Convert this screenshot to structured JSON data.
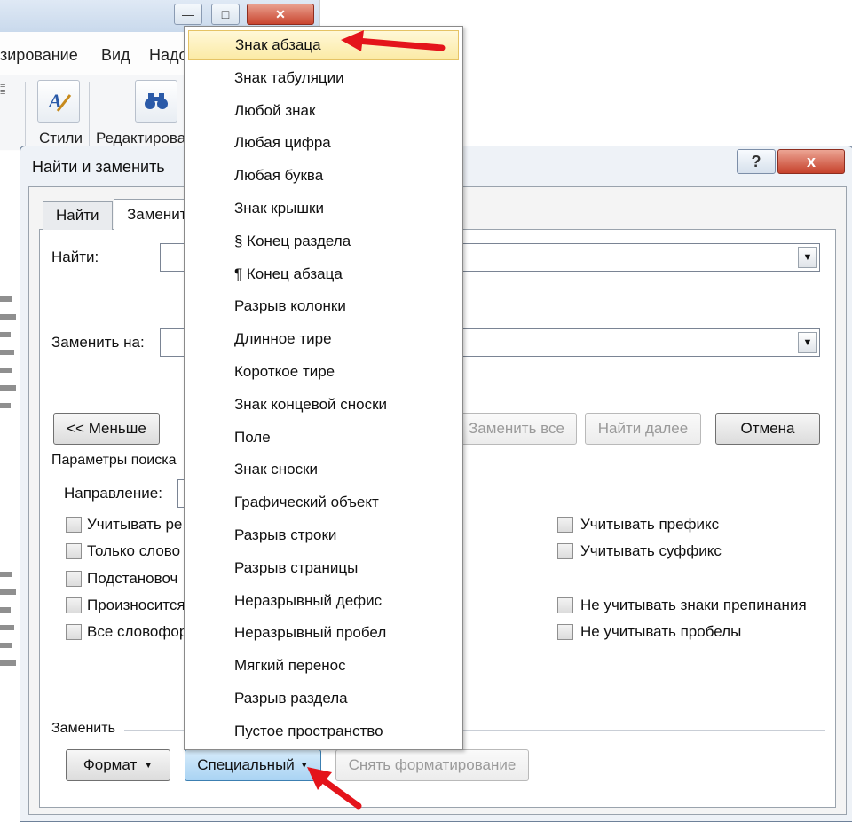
{
  "word": {
    "ribbon_tabs": [
      "зирование",
      "Вид",
      "Надо"
    ],
    "groups": [
      {
        "label": "Стили",
        "icon": "styles-icon"
      },
      {
        "label": "Редактирова",
        "icon": "binoculars-icon"
      }
    ]
  },
  "dialog": {
    "title": "Найти и заменить",
    "help_label": "?",
    "close_label": "x",
    "tabs": [
      "Найти",
      "Заменит"
    ],
    "find_label": "Найти:",
    "replace_label": "Заменить на:",
    "less_button": "<< Меньше",
    "replace_all_button": "Заменить все",
    "find_next_button": "Найти далее",
    "cancel_button": "Отмена",
    "search_params_label": "Параметры поиска",
    "direction_label": "Направление:",
    "options_left": [
      "Учитывать ре",
      "Только слово",
      "Подстановоч",
      "Произносится",
      "Все словофор"
    ],
    "options_right": [
      "Учитывать префикс",
      "Учитывать суффикс",
      "Не учитывать знаки препинания",
      "Не учитывать пробелы"
    ],
    "replace_section_label": "Заменить",
    "format_button": "Формат",
    "special_button": "Специальный",
    "clear_format_button": "Снять форматирование"
  },
  "special_menu": {
    "highlighted_index": 0,
    "items": [
      "Знак абзаца",
      "Знак табуляции",
      "Любой знак",
      "Любая цифра",
      "Любая буква",
      "Знак крышки",
      "§ Конец раздела",
      "¶ Конец абзаца",
      "Разрыв колонки",
      "Длинное тире",
      "Короткое тире",
      "Знак концевой сноски",
      "Поле",
      "Знак сноски",
      "Графический объект",
      "Разрыв строки",
      "Разрыв страницы",
      "Неразрывный дефис",
      "Неразрывный пробел",
      "Мягкий перенос",
      "Разрыв раздела",
      "Пустое пространство"
    ]
  },
  "colors": {
    "annotation_arrow": "#e4141b",
    "highlight": "#fbeaa5",
    "dialog_bg": "#eef2f7"
  }
}
